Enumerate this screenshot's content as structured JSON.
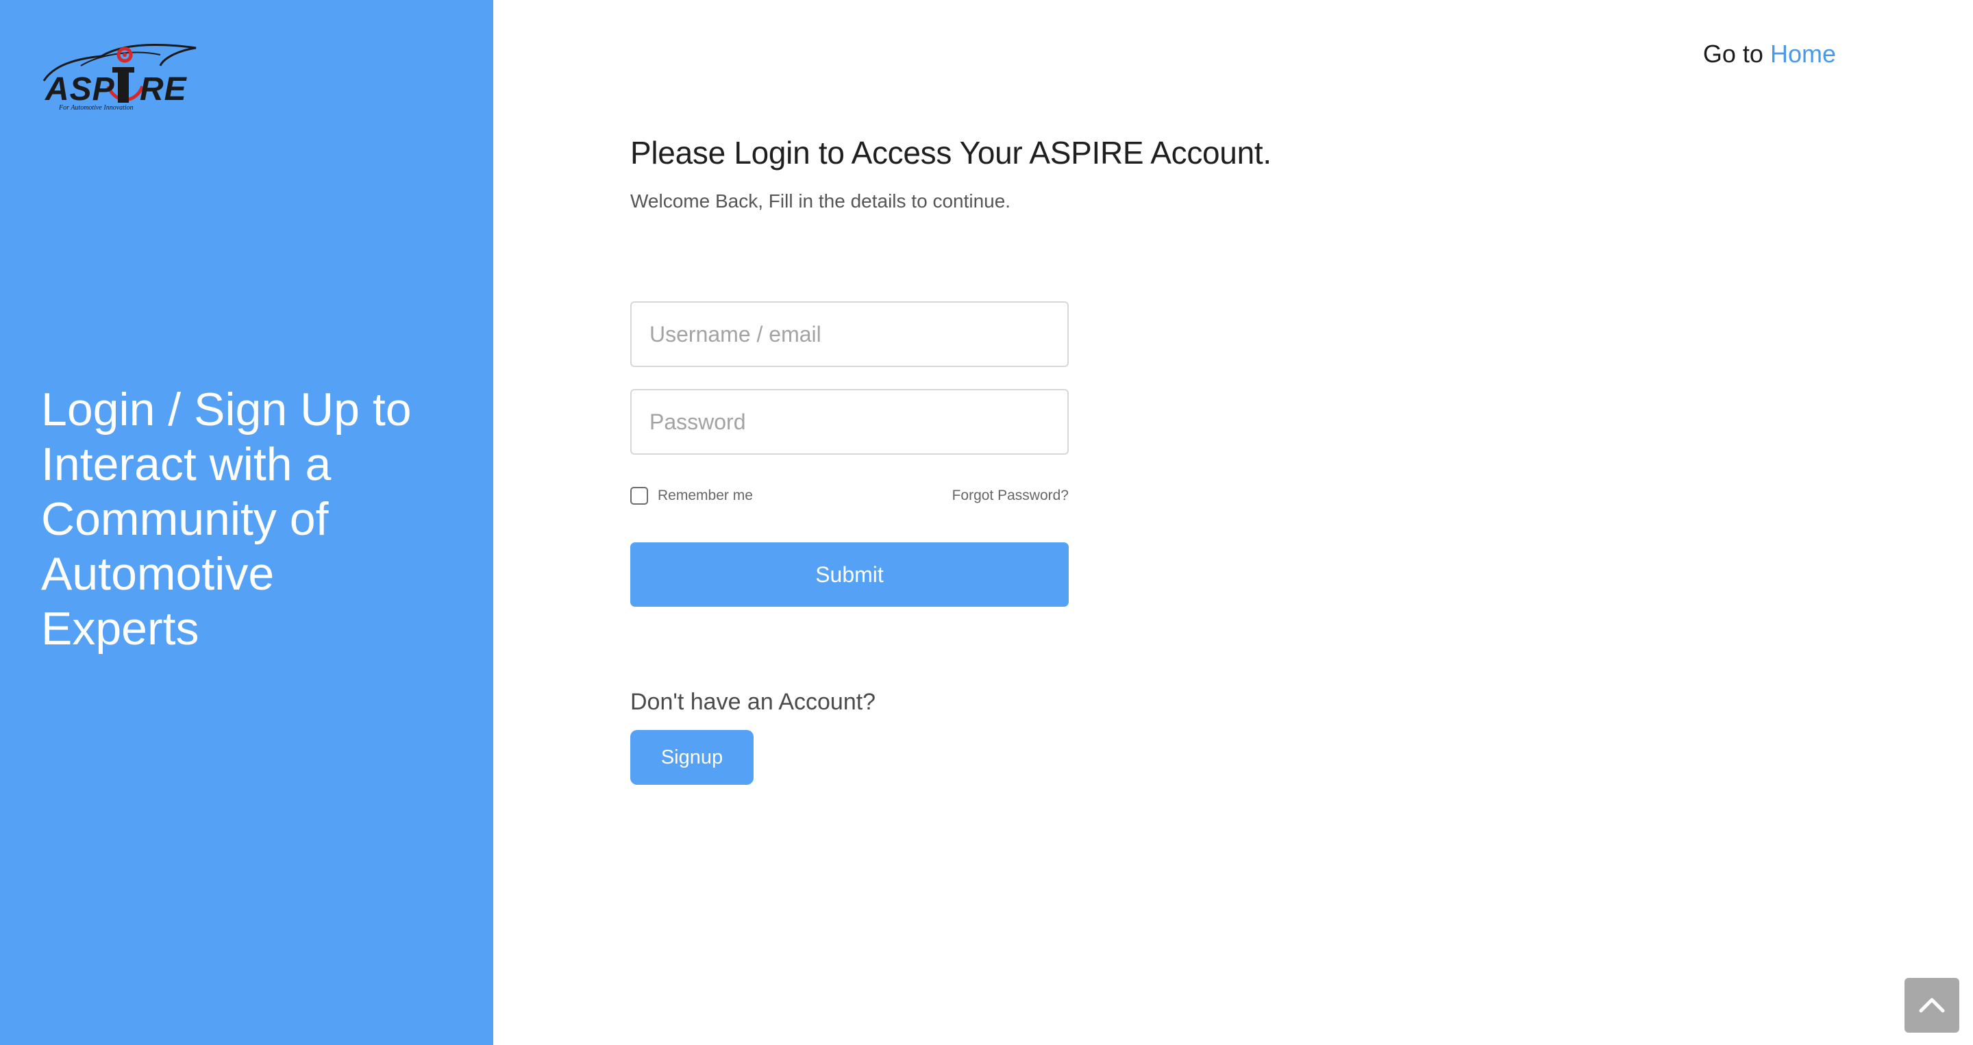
{
  "sidebar": {
    "logo": {
      "text": "ASPIRE",
      "tagline": "For Automotive Innovation",
      "icon": "aspire-car-gear-logo"
    },
    "headline": "Login / Sign Up to Interact with a Community of Automotive Experts"
  },
  "header": {
    "goto_prefix": "Go to",
    "home_link": "Home"
  },
  "login": {
    "title": "Please Login to Access Your ASPIRE Account.",
    "subtitle": "Welcome Back, Fill in the details to continue.",
    "username_placeholder": "Username / email",
    "password_placeholder": "Password",
    "username_value": "",
    "password_value": "",
    "remember_label": "Remember me",
    "remember_checked": false,
    "forgot_label": "Forgot Password?",
    "submit_label": "Submit"
  },
  "signup": {
    "prompt": "Don't have an Account?",
    "button_label": "Signup"
  },
  "scroll_top": {
    "icon": "chevron-up-icon"
  },
  "colors": {
    "brand_blue": "#55a1f5",
    "link_blue": "#4a98ea",
    "logo_red": "#d62828",
    "scroll_button": "#a8a8a8"
  }
}
